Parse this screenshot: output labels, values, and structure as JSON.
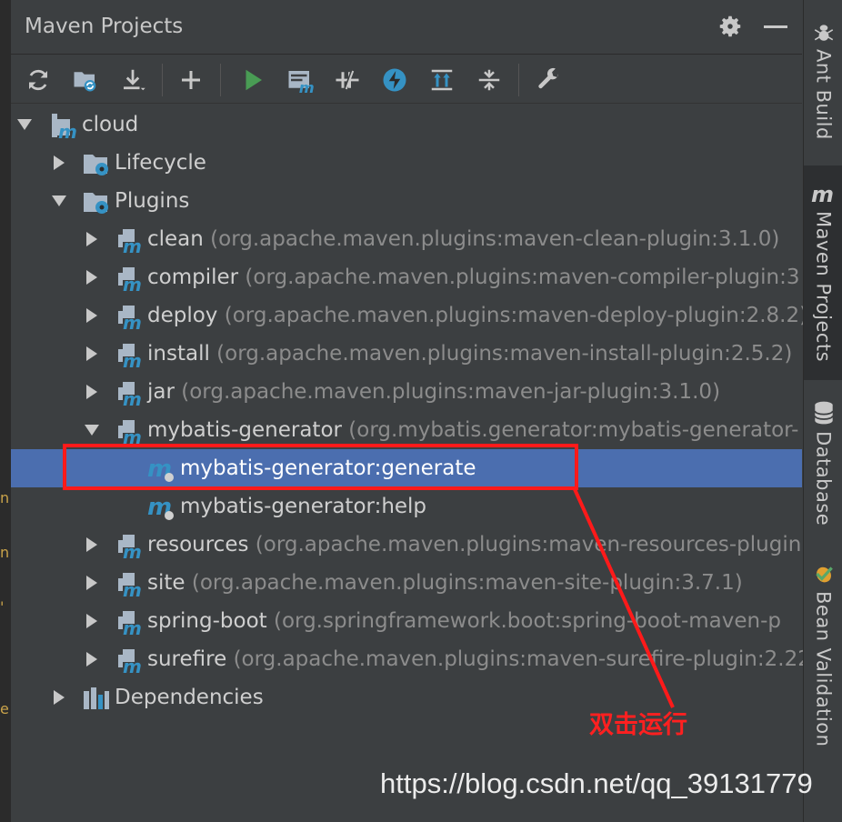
{
  "window": {
    "title": "Maven Projects"
  },
  "toolbar": {
    "buttons": [
      {
        "icon": "reimport-icon"
      },
      {
        "icon": "generate-sources-icon"
      },
      {
        "icon": "download-icon"
      },
      {
        "icon": "add-icon"
      },
      {
        "icon": "run-icon"
      },
      {
        "icon": "execute-goal-icon"
      },
      {
        "icon": "toggle-offline-icon"
      },
      {
        "icon": "skip-tests-icon"
      },
      {
        "icon": "expand-all-icon"
      },
      {
        "icon": "collapse-all-icon"
      },
      {
        "icon": "settings-wrench-icon"
      }
    ]
  },
  "tree": {
    "root": {
      "label": "cloud"
    },
    "lifecycle": {
      "label": "Lifecycle"
    },
    "plugins": {
      "label": "Plugins"
    },
    "plugin_items": [
      {
        "name": "clean",
        "coords": "(org.apache.maven.plugins:maven-clean-plugin:3.1.0)"
      },
      {
        "name": "compiler",
        "coords": "(org.apache.maven.plugins:maven-compiler-plugin:3"
      },
      {
        "name": "deploy",
        "coords": "(org.apache.maven.plugins:maven-deploy-plugin:2.8.2)"
      },
      {
        "name": "install",
        "coords": "(org.apache.maven.plugins:maven-install-plugin:2.5.2)"
      },
      {
        "name": "jar",
        "coords": "(org.apache.maven.plugins:maven-jar-plugin:3.1.0)"
      },
      {
        "name": "mybatis-generator",
        "coords": "(org.mybatis.generator:mybatis-generator-"
      }
    ],
    "goals": [
      {
        "label": "mybatis-generator:generate"
      },
      {
        "label": "mybatis-generator:help"
      }
    ],
    "plugin_items_after": [
      {
        "name": "resources",
        "coords": "(org.apache.maven.plugins:maven-resources-plugin"
      },
      {
        "name": "site",
        "coords": "(org.apache.maven.plugins:maven-site-plugin:3.7.1)"
      },
      {
        "name": "spring-boot",
        "coords": "(org.springframework.boot:spring-boot-maven-p"
      },
      {
        "name": "surefire",
        "coords": "(org.apache.maven.plugins:maven-surefire-plugin:2.22"
      }
    ],
    "dependencies": {
      "label": "Dependencies"
    }
  },
  "right_bar": {
    "tabs": [
      {
        "label": "Ant Build",
        "icon": "ant-icon"
      },
      {
        "label": "Maven Projects",
        "icon": "maven-icon"
      },
      {
        "label": "Database",
        "icon": "database-icon"
      },
      {
        "label": "Bean Validation",
        "icon": "bean-validation-icon"
      }
    ]
  },
  "annotation": {
    "text": "双击运行"
  },
  "watermark": {
    "text": "https://blog.csdn.net/qq_39131779"
  },
  "colors": {
    "panel_bg": "#3c3f41",
    "selection": "#4b6eaf",
    "annotation_red": "#ff1a1a",
    "run_green": "#499c54",
    "maven_blue": "#3592c4"
  }
}
